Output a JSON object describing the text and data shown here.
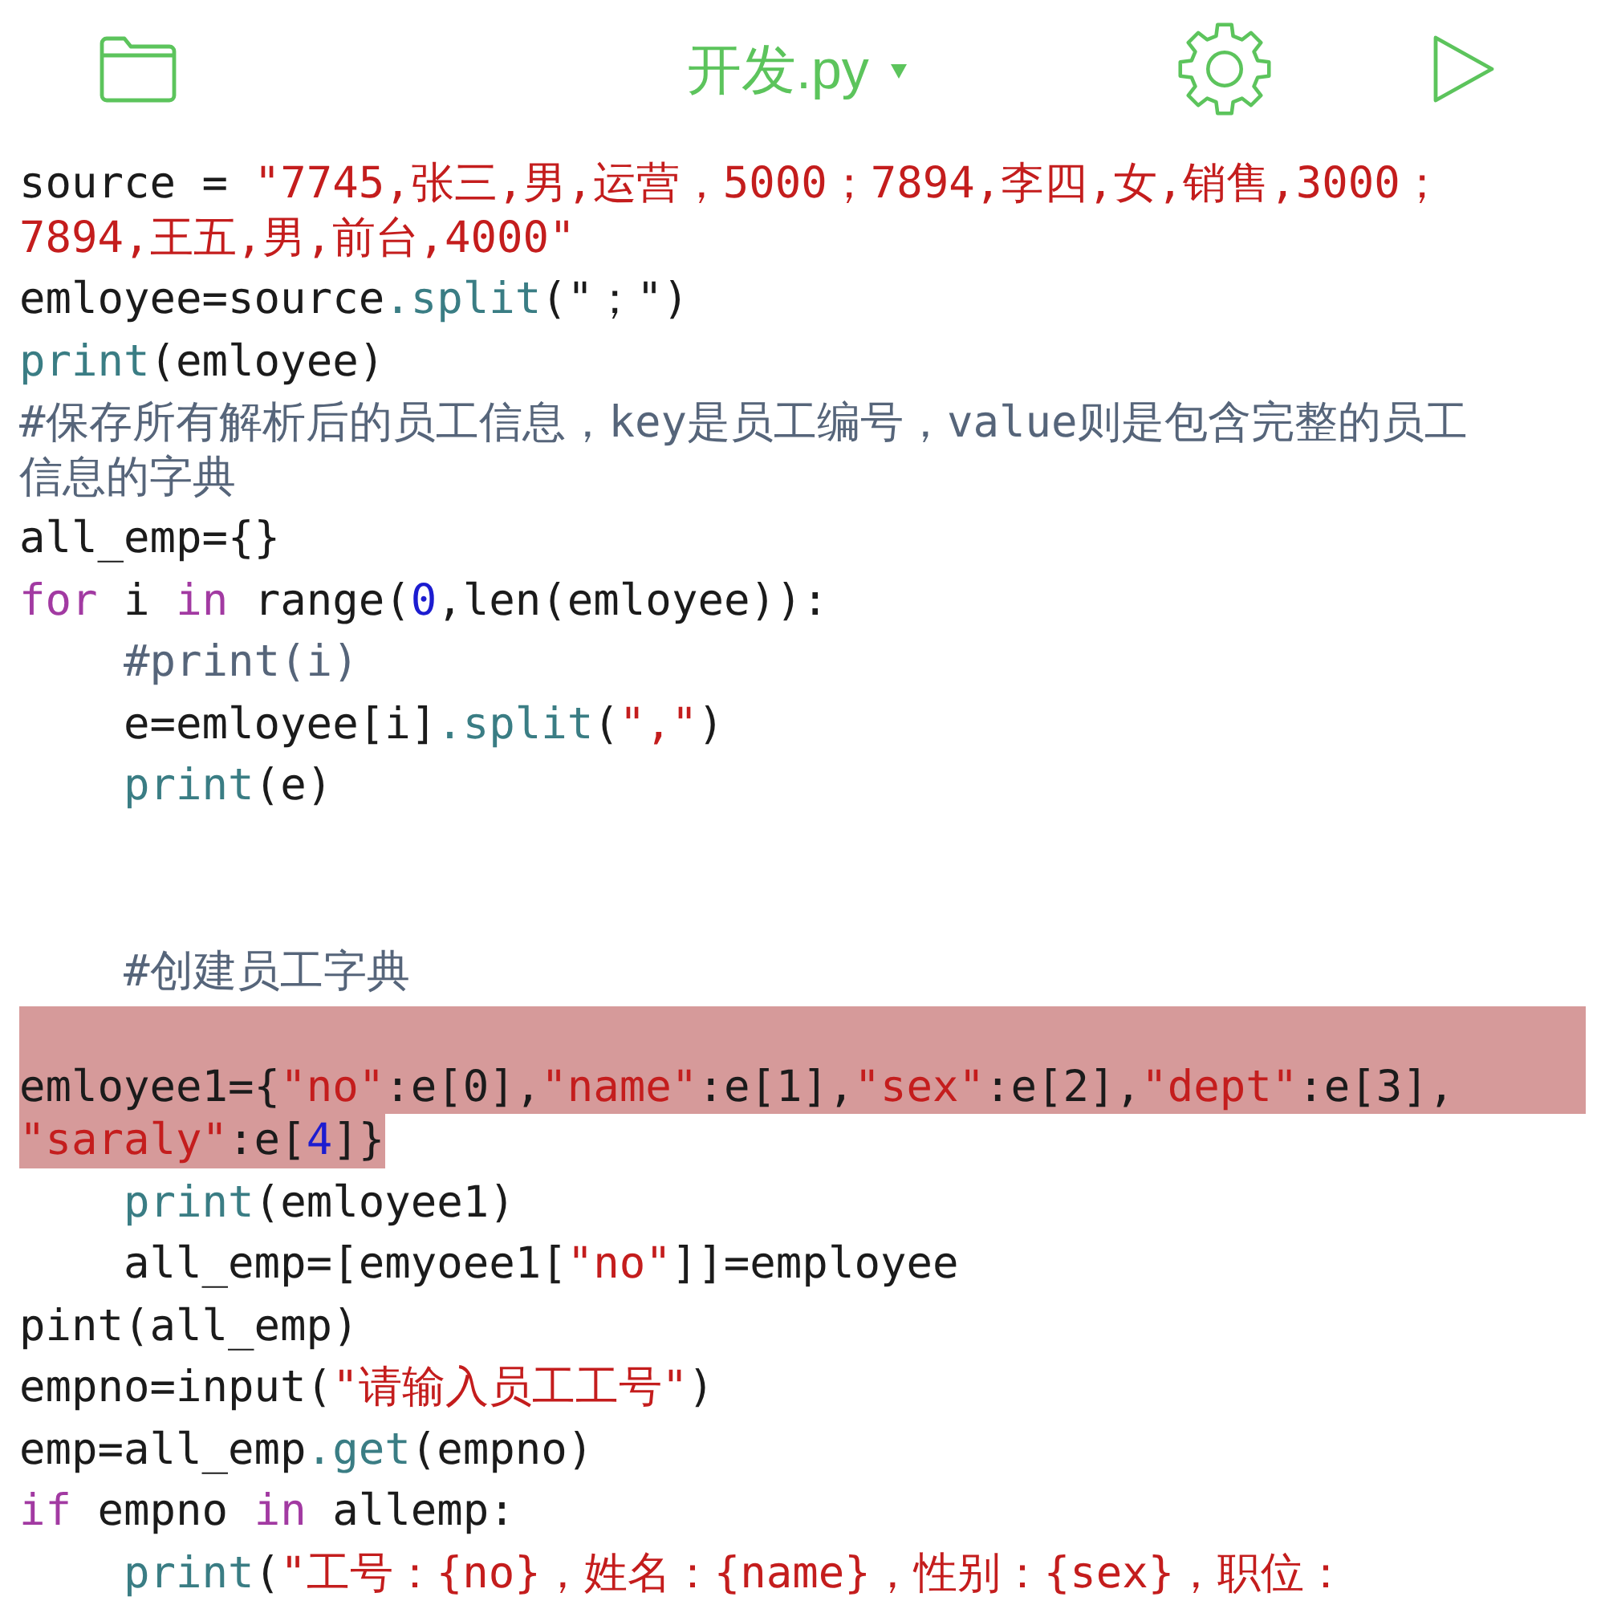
{
  "toolbar": {
    "file_name": "开发.py"
  },
  "code_lines": [
    {
      "selected": false,
      "wraps": [
        {
          "kind": "code",
          "spans": [
            {
              "kind": "plain",
              "text": "source = "
            },
            {
              "kind": "string",
              "text": "\"7745,张三,男,运营，5000；7894,李四,女,销售,3000；"
            }
          ]
        },
        {
          "kind": "code",
          "spans": [
            {
              "kind": "string",
              "text": "7894,王五,男,前台,4000\""
            }
          ]
        }
      ]
    },
    {
      "selected": false,
      "wraps": [
        {
          "kind": "code",
          "spans": [
            {
              "kind": "plain",
              "text": "emloyee=source"
            },
            {
              "kind": "builtin",
              "text": ".split"
            },
            {
              "kind": "plain",
              "text": "(\"；\")"
            }
          ]
        }
      ]
    },
    {
      "selected": false,
      "wraps": [
        {
          "kind": "code",
          "spans": [
            {
              "kind": "builtin",
              "text": "print"
            },
            {
              "kind": "plain",
              "text": "(emloyee)"
            }
          ]
        }
      ]
    },
    {
      "selected": false,
      "wraps": [
        {
          "kind": "code",
          "spans": [
            {
              "kind": "comment",
              "text": "#保存所有解析后的员工信息，key是员工编号，value则是包含完整的员工"
            }
          ]
        },
        {
          "kind": "code",
          "spans": [
            {
              "kind": "comment",
              "text": "信息的字典"
            }
          ]
        }
      ]
    },
    {
      "selected": false,
      "wraps": [
        {
          "kind": "code",
          "spans": [
            {
              "kind": "plain",
              "text": "all_emp={}"
            }
          ]
        }
      ]
    },
    {
      "selected": false,
      "wraps": [
        {
          "kind": "code",
          "spans": [
            {
              "kind": "keyword",
              "text": "for"
            },
            {
              "kind": "plain",
              "text": " i "
            },
            {
              "kind": "keyword",
              "text": "in"
            },
            {
              "kind": "plain",
              "text": " range("
            },
            {
              "kind": "number",
              "text": "0"
            },
            {
              "kind": "plain",
              "text": ",len(emloyee)):"
            }
          ]
        }
      ]
    },
    {
      "selected": false,
      "wraps": [
        {
          "kind": "code",
          "spans": [
            {
              "kind": "comment",
              "text": "    #print(i)"
            }
          ]
        }
      ]
    },
    {
      "selected": false,
      "wraps": [
        {
          "kind": "code",
          "spans": [
            {
              "kind": "plain",
              "text": "    e=emloyee[i]"
            },
            {
              "kind": "builtin",
              "text": ".split"
            },
            {
              "kind": "plain",
              "text": "("
            },
            {
              "kind": "string",
              "text": "\",\""
            },
            {
              "kind": "plain",
              "text": ")"
            }
          ]
        }
      ]
    },
    {
      "selected": false,
      "wraps": [
        {
          "kind": "code",
          "spans": [
            {
              "kind": "builtin",
              "text": "    print"
            },
            {
              "kind": "plain",
              "text": "(e)"
            }
          ]
        }
      ]
    },
    {
      "selected": false
    },
    {
      "selected": false
    },
    {
      "selected": false,
      "wraps": [
        {
          "kind": "code",
          "spans": [
            {
              "kind": "comment",
              "text": "    #创建员工字典"
            }
          ]
        }
      ]
    },
    {
      "selected": true,
      "wraps": [
        {
          "kind": "blank"
        },
        {
          "kind": "code",
          "spans": [
            {
              "kind": "plain",
              "text": "emloyee1={"
            },
            {
              "kind": "string",
              "text": "\"no\""
            },
            {
              "kind": "plain",
              "text": ":e[0],"
            },
            {
              "kind": "string",
              "text": "\"name\""
            },
            {
              "kind": "plain",
              "text": ":e[1],"
            },
            {
              "kind": "string",
              "text": "\"sex\""
            },
            {
              "kind": "plain",
              "text": ":e[2],"
            },
            {
              "kind": "string",
              "text": "\"dept\""
            },
            {
              "kind": "plain",
              "text": ":e[3],"
            }
          ]
        },
        {
          "kind": "code",
          "spans": [
            {
              "kind": "string",
              "text": "\"saraly\""
            },
            {
              "kind": "plain",
              "text": ":e["
            },
            {
              "kind": "number",
              "text": "4"
            },
            {
              "kind": "plain",
              "text": "]}"
            }
          ]
        }
      ]
    },
    {
      "selected": false,
      "wraps": [
        {
          "kind": "code",
          "spans": [
            {
              "kind": "builtin",
              "text": "    print"
            },
            {
              "kind": "plain",
              "text": "(emloyee1)"
            }
          ]
        }
      ]
    },
    {
      "selected": false,
      "wraps": [
        {
          "kind": "code",
          "spans": [
            {
              "kind": "plain",
              "text": "    all_emp=[emyoee1["
            },
            {
              "kind": "string",
              "text": "\"no\""
            },
            {
              "kind": "plain",
              "text": "]]=employee"
            }
          ]
        }
      ]
    },
    {
      "selected": false,
      "wraps": [
        {
          "kind": "code",
          "spans": [
            {
              "kind": "plain",
              "text": "pint(all_emp)"
            }
          ]
        }
      ]
    },
    {
      "selected": false,
      "wraps": [
        {
          "kind": "code",
          "spans": [
            {
              "kind": "plain",
              "text": "empno=input("
            },
            {
              "kind": "string",
              "text": "\"请输入员工工号\""
            },
            {
              "kind": "plain",
              "text": ")"
            }
          ]
        }
      ]
    },
    {
      "selected": false,
      "wraps": [
        {
          "kind": "code",
          "spans": [
            {
              "kind": "plain",
              "text": "emp=all_emp"
            },
            {
              "kind": "builtin",
              "text": ".get"
            },
            {
              "kind": "plain",
              "text": "(empno)"
            }
          ]
        }
      ]
    },
    {
      "selected": false,
      "wraps": [
        {
          "kind": "code",
          "spans": [
            {
              "kind": "keyword",
              "text": "if"
            },
            {
              "kind": "plain",
              "text": " empno "
            },
            {
              "kind": "keyword",
              "text": "in"
            },
            {
              "kind": "plain",
              "text": " allemp:"
            }
          ]
        }
      ]
    },
    {
      "selected": false,
      "wraps": [
        {
          "kind": "code",
          "spans": [
            {
              "kind": "builtin",
              "text": "    print"
            },
            {
              "kind": "plain",
              "text": "("
            },
            {
              "kind": "string",
              "text": "\"工号：{no}，姓名：{name}，性别：{sex}，职位："
            }
          ]
        }
      ]
    }
  ]
}
